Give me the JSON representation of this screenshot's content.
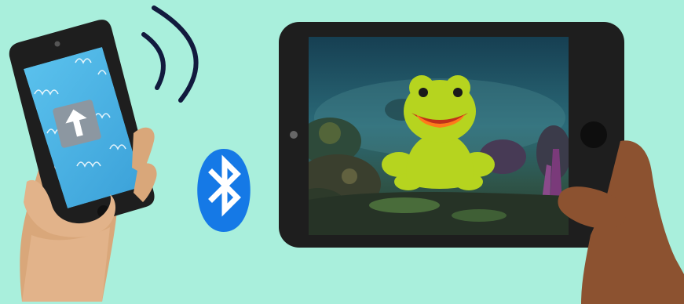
{
  "colors": {
    "background": "#a9efdc",
    "device_frame": "#1e1e1e",
    "phone_screen": "#4fb3e4",
    "arrow_tile": "#8c97a1",
    "arrow": "#ffffff",
    "bluetooth_badge": "#1579e6",
    "signal_waves": "#121a3e",
    "frog_body": "#b6d41f",
    "frog_mouth": "#e0431a",
    "frog_tongue": "#ff7a1a",
    "underwater_top": "#1a4a5a",
    "underwater_bottom": "#2a4036",
    "left_hand": "#d9a77a",
    "right_hand": "#8c5230"
  },
  "icons": {
    "phone": "smartphone-icon",
    "tablet": "tablet-icon",
    "arrow": "arrow-up-icon",
    "bluetooth": "bluetooth-icon",
    "signal": "signal-waves-icon",
    "frog": "frog-character"
  }
}
